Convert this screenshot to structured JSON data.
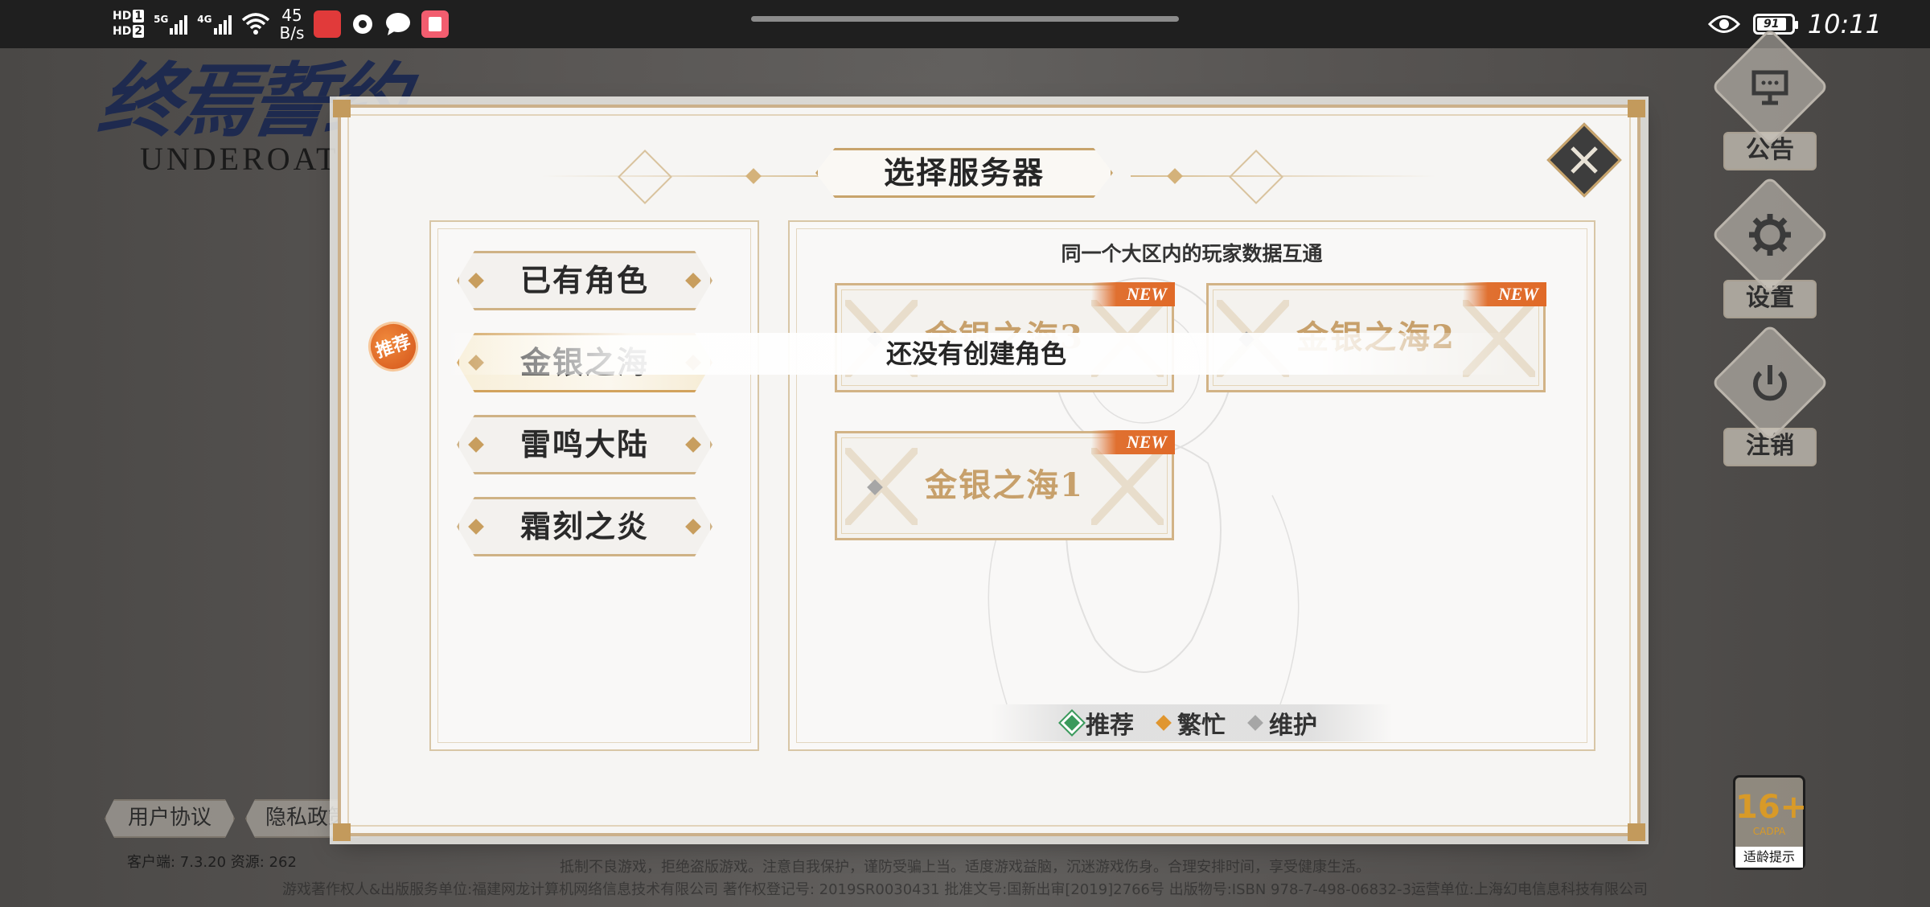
{
  "status_bar": {
    "sim1": "HD",
    "sim1_num": "1",
    "sim2": "HD",
    "sim2_num": "2",
    "net1": "5G",
    "net2": "4G",
    "speed_value": "45",
    "speed_unit": "B/s",
    "battery": "91",
    "time": "10:11",
    "icons": [
      "huawei-app-icon",
      "circle-app-icon",
      "chat-app-icon",
      "book-app-icon",
      "eye-icon"
    ]
  },
  "logo": {
    "title": "终焉誓约",
    "subtitle": "UNDEROATH"
  },
  "side_menu": [
    {
      "label": "公告",
      "icon": "notice-board-icon"
    },
    {
      "label": "设置",
      "icon": "gear-icon"
    },
    {
      "label": "注销",
      "icon": "power-icon"
    }
  ],
  "dialog": {
    "title": "选择服务器",
    "info": "同一个大区内的玩家数据互通",
    "regions": [
      {
        "label": "已有角色"
      },
      {
        "label": "金银之海",
        "active": true,
        "badge": "推荐"
      },
      {
        "label": "雷鸣大陆"
      },
      {
        "label": "霜刻之炎"
      }
    ],
    "servers": [
      {
        "name": "金银之海3",
        "tag": "NEW",
        "status": "maintenance"
      },
      {
        "name": "金银之海2",
        "tag": "NEW",
        "status": "maintenance"
      },
      {
        "name": "金银之海1",
        "tag": "NEW",
        "status": "maintenance"
      }
    ],
    "legend": [
      {
        "label": "推荐",
        "color": "#3a9a5c"
      },
      {
        "label": "繁忙",
        "color": "#e0962f"
      },
      {
        "label": "维护",
        "color": "#a6a6a6"
      }
    ],
    "toast": "还没有创建角色"
  },
  "bottom": {
    "user_agreement": "用户协议",
    "privacy_policy": "隐私政策",
    "version": "客户端: 7.3.20  资源: 262",
    "notice_line1": "抵制不良游戏，拒绝盗版游戏。注意自我保护，谨防受骗上当。适度游戏益脑，沉迷游戏伤身。合理安排时间，享受健康生活。",
    "notice_line2": "游戏著作权人&出版服务单位:福建网龙计算机网络信息技术有限公司  著作权登记号: 2019SR0030431  批准文号:国新出审[2019]2766号  出版物号:ISBN 978-7-498-06832-3运营单位:上海幻电信息科技有限公司",
    "age_rating": "16+",
    "age_org": "CADPA",
    "age_tip": "适龄提示"
  }
}
